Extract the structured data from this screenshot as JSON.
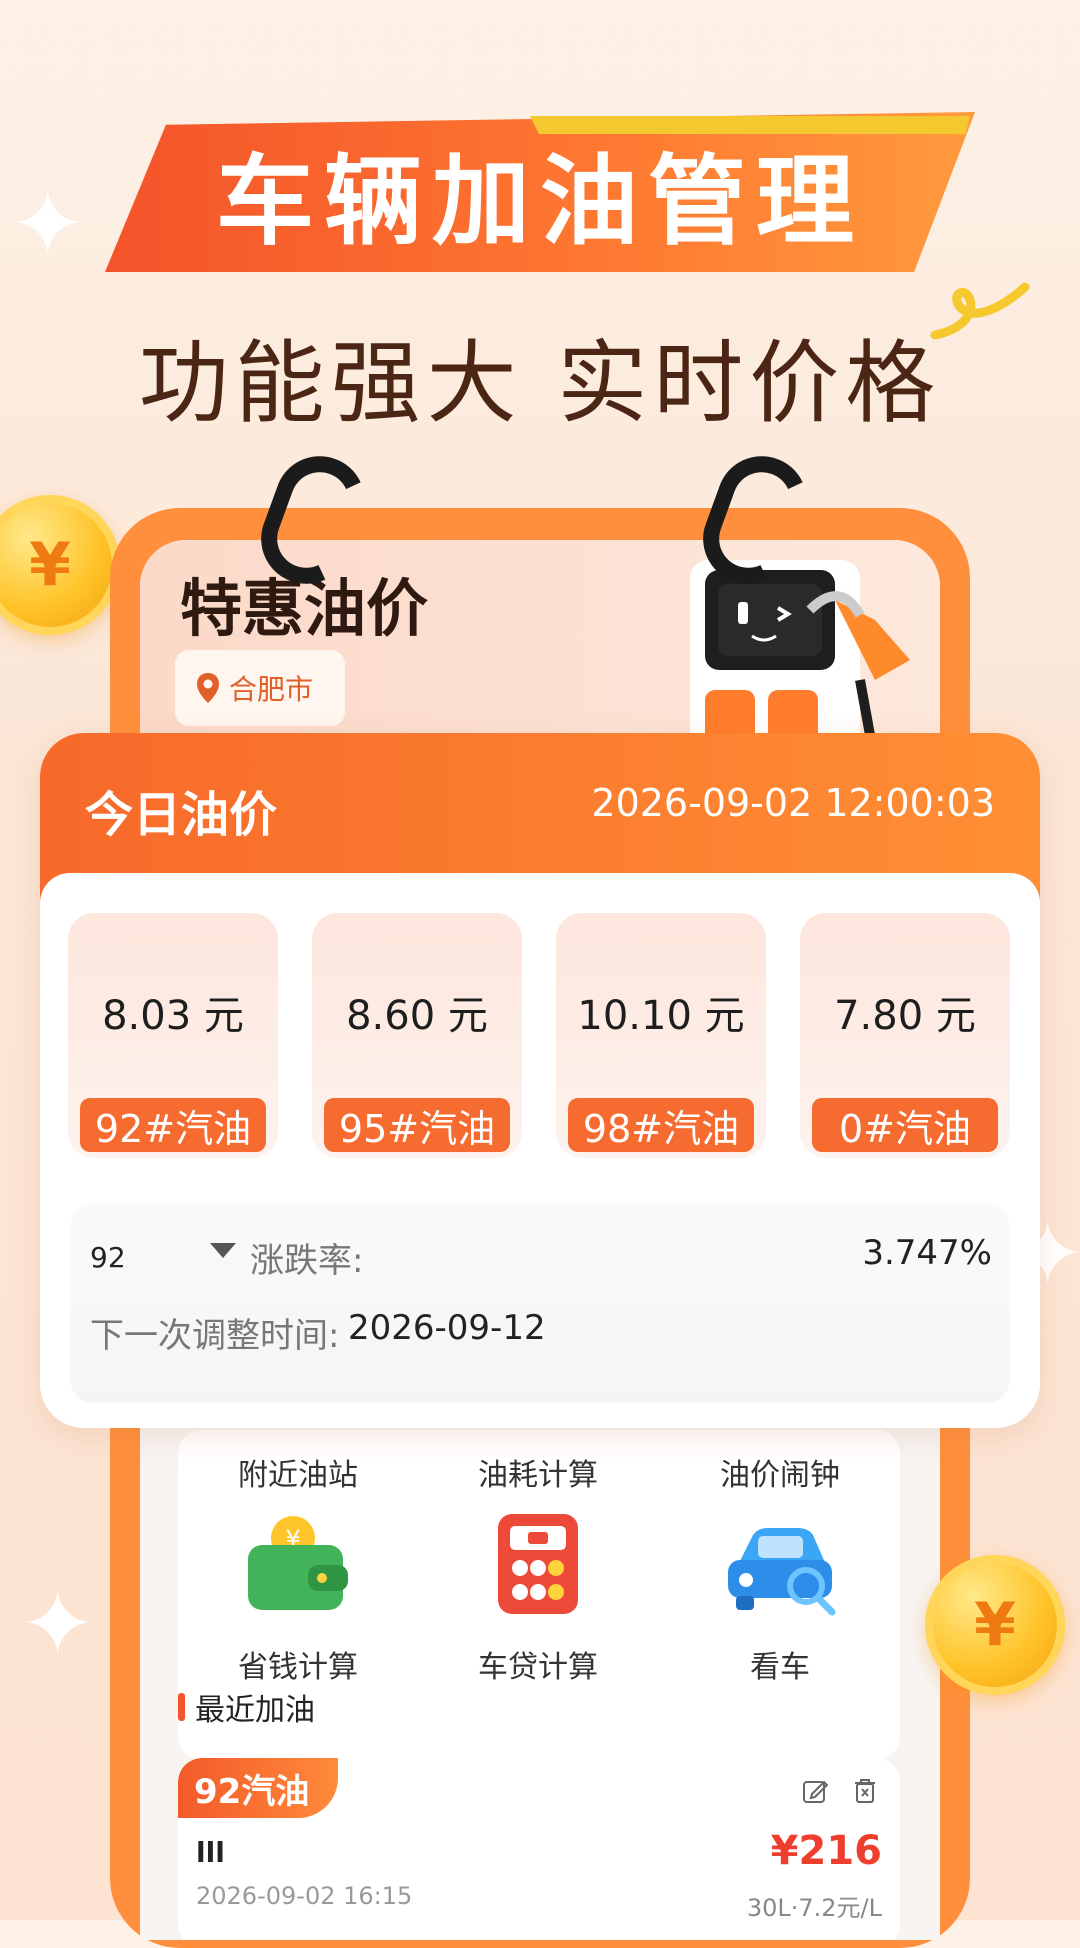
{
  "promo": {
    "headline": "车辆加油管理",
    "subheadline": "功能强大 实时价格"
  },
  "app": {
    "title": "特惠油价",
    "location": "合肥市",
    "location_icon": "location-pin-icon"
  },
  "today_price": {
    "title": "今日油价",
    "datetime": "2026-09-02 12:00:03",
    "fuels": [
      {
        "price": "8.03 元",
        "label": "92#汽油"
      },
      {
        "price": "8.60 元",
        "label": "95#汽油"
      },
      {
        "price": "10.10 元",
        "label": "98#汽油"
      },
      {
        "price": "7.80 元",
        "label": "0#汽油"
      }
    ],
    "rate": {
      "code": "92",
      "label": "涨跌率:",
      "value": "3.747%"
    },
    "next_adjust": {
      "label": "下一次调整时间:",
      "value": "2026-09-12"
    }
  },
  "tools": {
    "row1": [
      "附近油站",
      "油耗计算",
      "油价闹钟"
    ],
    "row2": [
      "省钱计算",
      "车贷计算",
      "看车"
    ],
    "icons": [
      "wallet-icon",
      "calculator-icon",
      "car-search-icon"
    ]
  },
  "recent": {
    "title": "最近加油",
    "record": {
      "tag": "92汽油",
      "name": "lll",
      "date": "2026-09-02  16:15",
      "amount": "¥216",
      "detail": "30L·7.2元/L"
    }
  },
  "colors": {
    "accent": "#f66b30",
    "price_red": "#ee3e2d",
    "frame": "#ff8f3c"
  }
}
